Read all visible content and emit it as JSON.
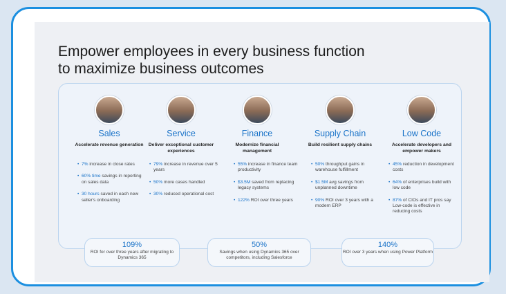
{
  "title": {
    "line1": "Empower employees in every business function",
    "line2": "to maximize business outcomes"
  },
  "columns": [
    {
      "name": "Sales",
      "subtitle": "Accelerate revenue generation",
      "bullets": [
        {
          "hl": "7%",
          "text": " increase in close rates"
        },
        {
          "hl": "60% time",
          "text": " savings in reporting on sales data"
        },
        {
          "hl": "30 hours",
          "text": " saved in each new seller's onboarding"
        }
      ]
    },
    {
      "name": "Service",
      "subtitle": "Deliver exceptional customer experiences",
      "bullets": [
        {
          "hl": "79%",
          "text": " increase in revenue over 5 years"
        },
        {
          "hl": "50%",
          "text": " more cases handled"
        },
        {
          "hl": "30%",
          "text": " reduced operational cost"
        }
      ]
    },
    {
      "name": "Finance",
      "subtitle": "Modernize financial management",
      "bullets": [
        {
          "hl": "55%",
          "text": " increase in finance team productivity"
        },
        {
          "hl": "$3.5M",
          "text": " saved from replacing legacy systems"
        },
        {
          "hl": "122%",
          "text": " ROI over three years"
        }
      ]
    },
    {
      "name": "Supply Chain",
      "subtitle": "Build resilient supply chains",
      "bullets": [
        {
          "hl": "50%",
          "text": " throughput gains in warehouse fulfillment"
        },
        {
          "hl": "$1.5M",
          "text": " avg savings from unplanned downtime"
        },
        {
          "hl": "90%",
          "text": " ROI over 3 years with a modern ERP"
        }
      ]
    },
    {
      "name": "Low Code",
      "subtitle": "Accelerate developers and empower makers",
      "bullets": [
        {
          "hl": "45%",
          "text": " reduction in development costs"
        },
        {
          "hl": "64%",
          "text": " of enterprises build with low code"
        },
        {
          "hl": "87%",
          "text": " of CIOs and IT pros say Low-code is effective in reducing costs"
        }
      ]
    }
  ],
  "roi": [
    {
      "value": "109%",
      "text": "ROI for over three years after migrating to Dynamics 365"
    },
    {
      "value": "50%",
      "text": "Savings when using Dynamics 365 over competitors, including Salesforce"
    },
    {
      "value": "140%",
      "text": "ROI over 3 years when using Power Platform"
    }
  ]
}
